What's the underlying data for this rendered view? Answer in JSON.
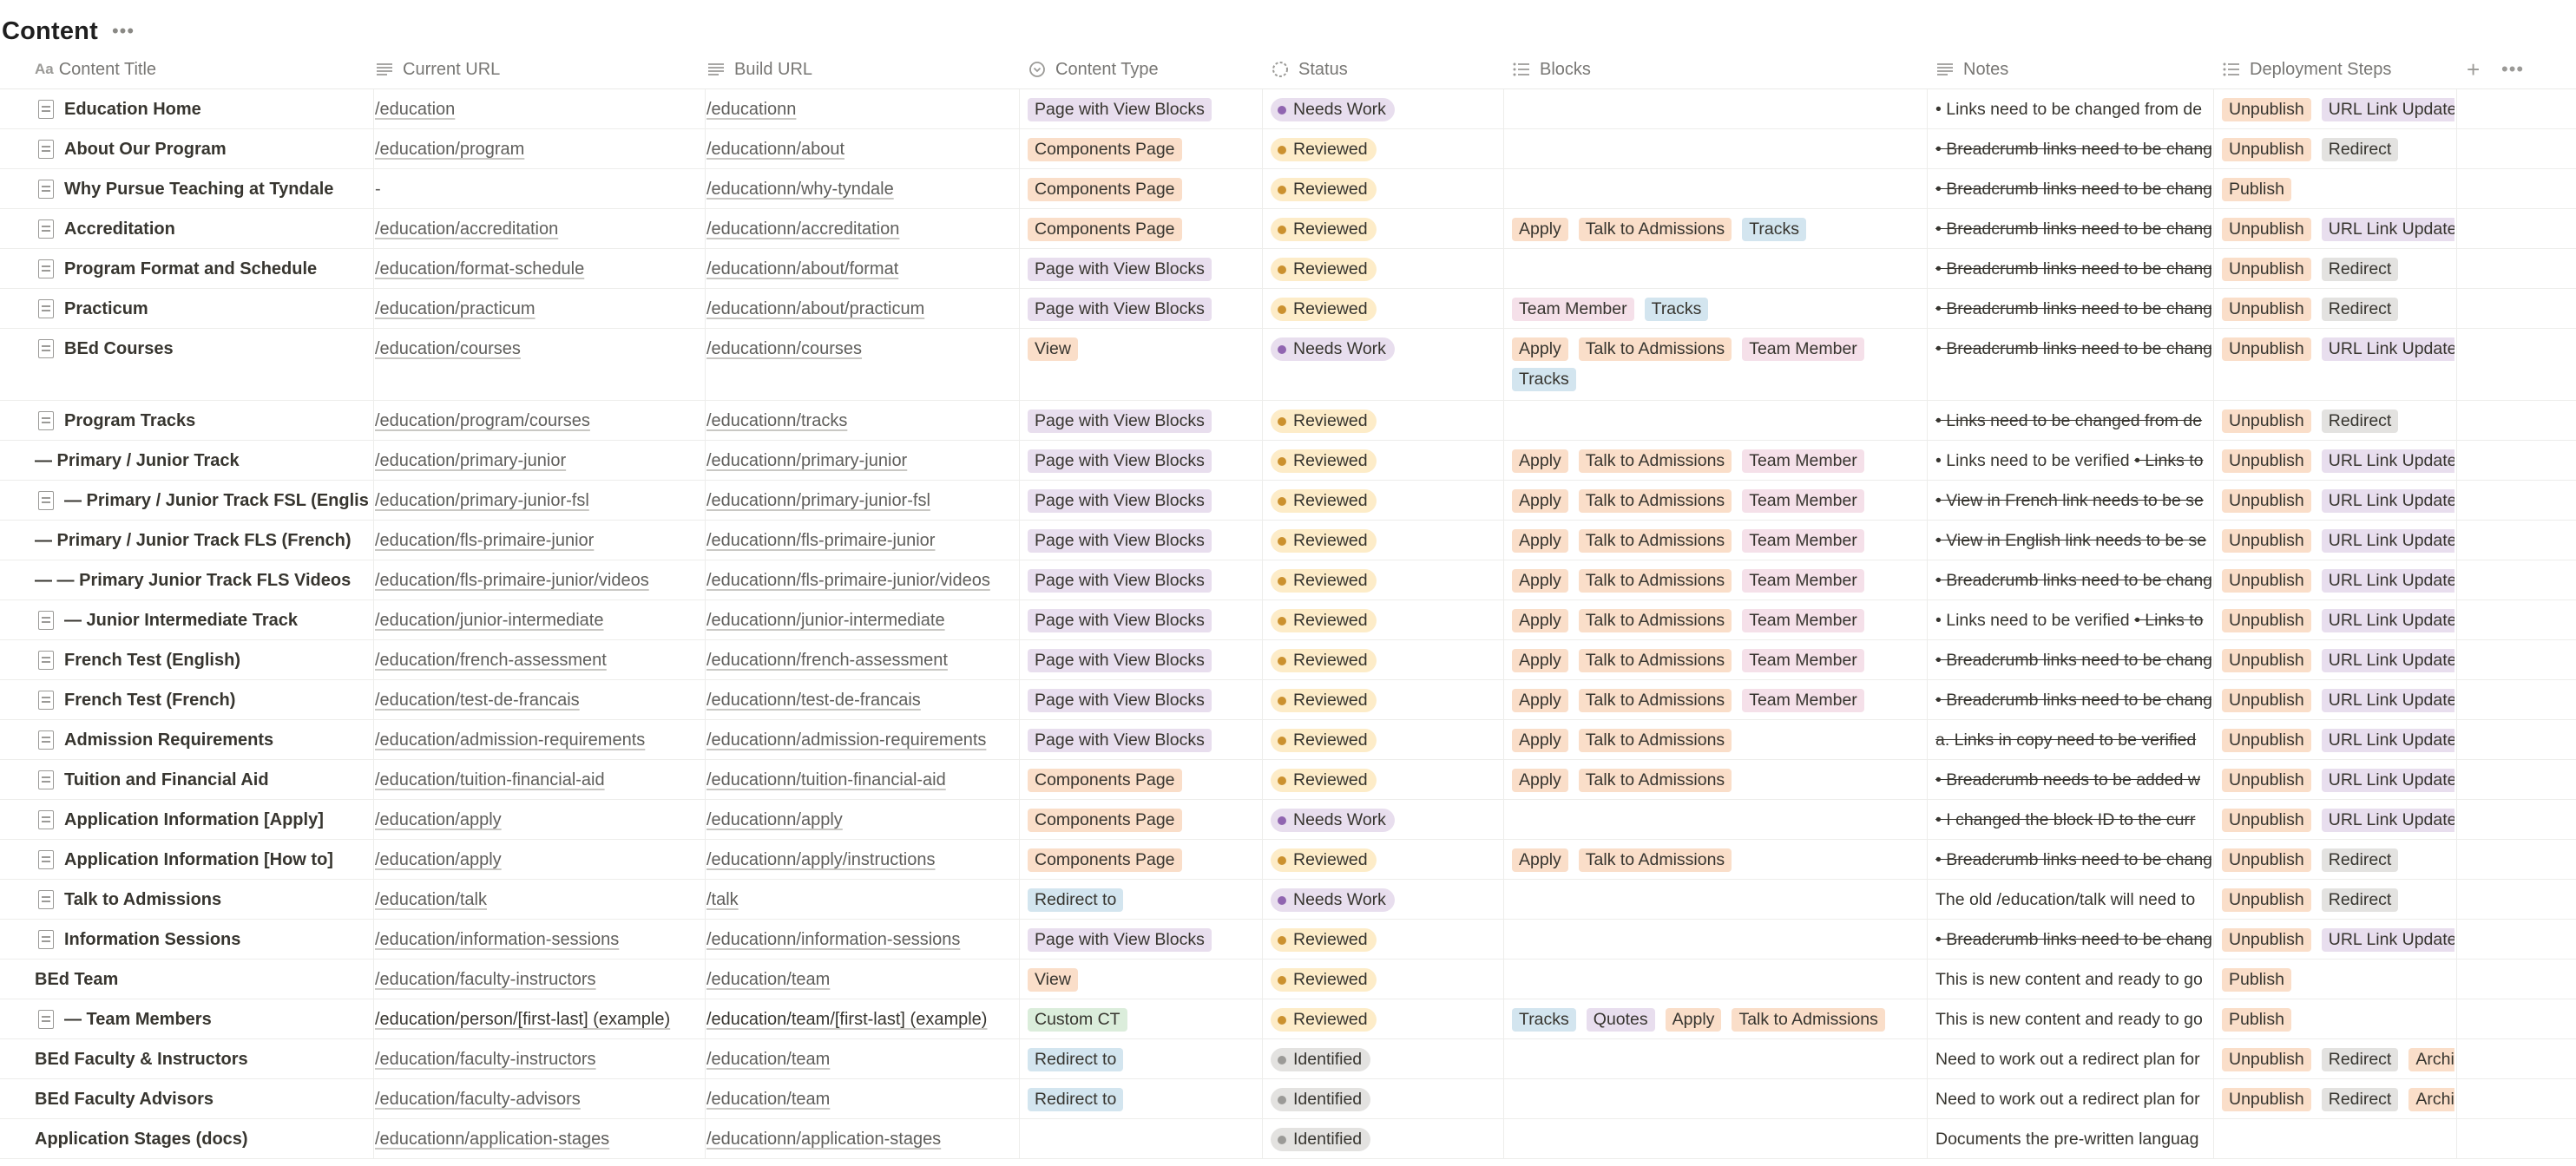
{
  "page": {
    "title": "Content"
  },
  "columns": {
    "content_title": "Content Title",
    "current_url": "Current URL",
    "build_url": "Build URL",
    "content_type": "Content Type",
    "status": "Status",
    "blocks": "Blocks",
    "notes": "Notes",
    "deployment_steps": "Deployment Steps"
  },
  "colors": {
    "Page with View Blocks": "#e8deee",
    "Components Page": "#fadec9",
    "View": "#fadec9",
    "Redirect to": "#d3e5ef",
    "Custom CT": "#dbeddb",
    "Apply": "#fadec9",
    "Talk to Admissions": "#fadec9",
    "Tracks": "#d3e5ef",
    "Team Member": "#f5e0e9",
    "Quotes": "#e8deee",
    "Unpublish": "#fadec9",
    "URL Link Updates": "#e8deee",
    "Redirect": "#e3e2e0",
    "Publish": "#fadec9",
    "Archive": "#fadec9"
  },
  "status_colors": {
    "Needs Work": {
      "bg": "#e8deee",
      "dot": "#9065b0"
    },
    "Reviewed": {
      "bg": "#fdecc8",
      "dot": "#cb912f"
    },
    "Identified": {
      "bg": "#e3e2e0",
      "dot": "#9b9a97"
    }
  },
  "rows": [
    {
      "title": "Education Home",
      "icon": true,
      "current_url": "/education",
      "build_url": "/educationn",
      "type": "Page with View Blocks",
      "status": "Needs Work",
      "blocks": [],
      "note_plain": "• Links need to be changed from de",
      "note_strike": "",
      "deploy": [
        "Unpublish",
        "URL Link Updates"
      ]
    },
    {
      "title": "About Our Program",
      "icon": true,
      "current_url": "/education/program",
      "build_url": "/educationn/about",
      "type": "Components Page",
      "status": "Reviewed",
      "blocks": [],
      "note_plain": "",
      "note_strike": "• Breadcrumb links need to be change",
      "deploy": [
        "Unpublish",
        "Redirect"
      ]
    },
    {
      "title": "Why Pursue Teaching at Tyndale",
      "icon": true,
      "current_url": "-",
      "build_url": "/educationn/why-tyndale",
      "type": "Components Page",
      "status": "Reviewed",
      "blocks": [],
      "note_plain": "",
      "note_strike": "• Breadcrumb links need to be change",
      "deploy": [
        "Publish"
      ]
    },
    {
      "title": "Accreditation",
      "icon": true,
      "current_url": "/education/accreditation",
      "build_url": "/educationn/accreditation",
      "type": "Components Page",
      "status": "Reviewed",
      "blocks": [
        "Apply",
        "Talk to Admissions",
        "Tracks"
      ],
      "note_plain": "",
      "note_strike": "• Breadcrumb links need to be change",
      "deploy": [
        "Unpublish",
        "URL Link Updates"
      ]
    },
    {
      "title": "Program Format and Schedule",
      "icon": true,
      "current_url": "/education/format-schedule",
      "build_url": "/educationn/about/format",
      "type": "Page with View Blocks",
      "status": "Reviewed",
      "blocks": [],
      "note_plain": "",
      "note_strike": "• Breadcrumb links need to be change",
      "deploy": [
        "Unpublish",
        "Redirect"
      ]
    },
    {
      "title": "Practicum",
      "icon": true,
      "current_url": "/education/practicum",
      "build_url": "/educationn/about/practicum",
      "type": "Page with View Blocks",
      "status": "Reviewed",
      "blocks": [
        "Team Member",
        "Tracks"
      ],
      "note_plain": "",
      "note_strike": "• Breadcrumb links need to be change",
      "deploy": [
        "Unpublish",
        "Redirect"
      ]
    },
    {
      "title": "BEd Courses",
      "icon": true,
      "tall": true,
      "current_url": "/education/courses",
      "build_url": "/educationn/courses",
      "type": "View",
      "status": "Needs Work",
      "blocks": [
        "Apply",
        "Talk to Admissions",
        "Team Member",
        "Tracks"
      ],
      "note_plain": "",
      "note_strike": "• Breadcrumb links need to be change",
      "deploy": [
        "Unpublish",
        "URL Link Updates"
      ]
    },
    {
      "title": "Program Tracks",
      "icon": true,
      "current_url": "/education/program/courses",
      "build_url": "/educationn/tracks",
      "type": "Page with View Blocks",
      "status": "Reviewed",
      "blocks": [],
      "note_plain": "",
      "note_strike": "• Links need to be changed from de",
      "deploy": [
        "Unpublish",
        "Redirect"
      ]
    },
    {
      "title": "— Primary / Junior Track",
      "icon": false,
      "current_url": "/education/primary-junior",
      "build_url": "/educationn/primary-junior",
      "type": "Page with View Blocks",
      "status": "Reviewed",
      "blocks": [
        "Apply",
        "Talk to Admissions",
        "Team Member"
      ],
      "note_plain": "• Links need to be verified ",
      "note_strike": "• Links to",
      "deploy": [
        "Unpublish",
        "URL Link Updates"
      ]
    },
    {
      "title": "— Primary / Junior Track FSL (English)",
      "icon": true,
      "current_url": "/education/primary-junior-fsl",
      "build_url": "/educationn/primary-junior-fsl",
      "type": "Page with View Blocks",
      "status": "Reviewed",
      "blocks": [
        "Apply",
        "Talk to Admissions",
        "Team Member"
      ],
      "note_plain": "",
      "note_strike": "• View in French link needs to be se",
      "deploy": [
        "Unpublish",
        "URL Link Updates"
      ]
    },
    {
      "title": "— Primary / Junior Track FLS (French)",
      "icon": false,
      "current_url": "/education/fls-primaire-junior",
      "build_url": "/educationn/fls-primaire-junior",
      "type": "Page with View Blocks",
      "status": "Reviewed",
      "blocks": [
        "Apply",
        "Talk to Admissions",
        "Team Member"
      ],
      "note_plain": "",
      "note_strike": "• View in English link needs to be se",
      "deploy": [
        "Unpublish",
        "URL Link Updates"
      ]
    },
    {
      "title": "— — Primary Junior Track FLS Videos",
      "icon": false,
      "current_url": "/education/fls-primaire-junior/videos",
      "build_url": "/educationn/fls-primaire-junior/videos",
      "type": "Page with View Blocks",
      "status": "Reviewed",
      "blocks": [
        "Apply",
        "Talk to Admissions",
        "Team Member"
      ],
      "note_plain": "",
      "note_strike": "• Breadcrumb links need to be change",
      "deploy": [
        "Unpublish",
        "URL Link Updates"
      ]
    },
    {
      "title": "— Junior Intermediate Track",
      "icon": true,
      "current_url": "/education/junior-intermediate",
      "build_url": "/educationn/junior-intermediate",
      "type": "Page with View Blocks",
      "status": "Reviewed",
      "blocks": [
        "Apply",
        "Talk to Admissions",
        "Team Member"
      ],
      "note_plain": "• Links need to be verified ",
      "note_strike": "• Links to",
      "deploy": [
        "Unpublish",
        "URL Link Updates"
      ]
    },
    {
      "title": "French Test (English)",
      "icon": true,
      "current_url": "/education/french-assessment",
      "build_url": "/educationn/french-assessment",
      "type": "Page with View Blocks",
      "status": "Reviewed",
      "blocks": [
        "Apply",
        "Talk to Admissions",
        "Team Member"
      ],
      "note_plain": "",
      "note_strike": "• Breadcrumb links need to be change",
      "deploy": [
        "Unpublish",
        "URL Link Updates"
      ]
    },
    {
      "title": "French Test (French)",
      "icon": true,
      "current_url": "/education/test-de-francais",
      "build_url": "/educationn/test-de-francais",
      "type": "Page with View Blocks",
      "status": "Reviewed",
      "blocks": [
        "Apply",
        "Talk to Admissions",
        "Team Member"
      ],
      "note_plain": "",
      "note_strike": "• Breadcrumb links need to be change",
      "deploy": [
        "Unpublish",
        "URL Link Updates"
      ]
    },
    {
      "title": "Admission Requirements",
      "icon": true,
      "current_url": "/education/admission-requirements",
      "build_url": "/educationn/admission-requirements",
      "type": "Page with View Blocks",
      "status": "Reviewed",
      "blocks": [
        "Apply",
        "Talk to Admissions"
      ],
      "note_plain": "",
      "note_strike": "a. Links in copy need to be verified",
      "deploy": [
        "Unpublish",
        "URL Link Updates"
      ]
    },
    {
      "title": "Tuition and Financial Aid",
      "icon": true,
      "current_url": "/education/tuition-financial-aid",
      "build_url": "/educationn/tuition-financial-aid",
      "type": "Components Page",
      "status": "Reviewed",
      "blocks": [
        "Apply",
        "Talk to Admissions"
      ],
      "note_plain": "",
      "note_strike": "• Breadcrumb needs to be added w",
      "deploy": [
        "Unpublish",
        "URL Link Updates"
      ]
    },
    {
      "title": "Application Information [Apply]",
      "icon": true,
      "current_url": "/education/apply",
      "build_url": "/educationn/apply",
      "type": "Components Page",
      "status": "Needs Work",
      "blocks": [],
      "note_plain": "",
      "note_strike": "• I changed the block ID to the curr",
      "deploy": [
        "Unpublish",
        "URL Link Updates"
      ]
    },
    {
      "title": "Application Information [How to]",
      "icon": true,
      "current_url": "/education/apply",
      "build_url": "/educationn/apply/instructions",
      "type": "Components Page",
      "status": "Reviewed",
      "blocks": [
        "Apply",
        "Talk to Admissions"
      ],
      "note_plain": "",
      "note_strike": "• Breadcrumb links need to be change",
      "deploy": [
        "Unpublish",
        "Redirect"
      ]
    },
    {
      "title": "Talk to Admissions",
      "icon": true,
      "current_url": "/education/talk",
      "build_url": "/talk",
      "type": "Redirect to",
      "status": "Needs Work",
      "blocks": [],
      "note_plain": "The old /education/talk will need to",
      "note_strike": "",
      "deploy": [
        "Unpublish",
        "Redirect"
      ]
    },
    {
      "title": "Information Sessions",
      "icon": true,
      "current_url": "/education/information-sessions",
      "build_url": "/educationn/information-sessions",
      "type": "Page with View Blocks",
      "status": "Reviewed",
      "blocks": [],
      "note_plain": "",
      "note_strike": "• Breadcrumb links need to be change",
      "deploy": [
        "Unpublish",
        "URL Link Updates"
      ]
    },
    {
      "title": "BEd Team",
      "icon": false,
      "current_url": "/education/faculty-instructors",
      "build_url": "/education/team",
      "type": "View",
      "status": "Reviewed",
      "blocks": [],
      "note_plain": "This is new content and ready to go",
      "note_strike": "",
      "deploy": [
        "Publish"
      ]
    },
    {
      "title": "— Team Members",
      "icon": true,
      "current_url": "/education/person/[first-last] (example)",
      "build_url": "/education/team/[first-last] (example)",
      "type": "Custom CT",
      "status": "Reviewed",
      "blocks": [
        "Tracks",
        "Quotes",
        "Apply",
        "Talk to Admissions"
      ],
      "note_plain": "This is new content and ready to go",
      "note_strike": "",
      "deploy": [
        "Publish"
      ]
    },
    {
      "title": "BEd Faculty & Instructors",
      "icon": false,
      "current_url": "/education/faculty-instructors",
      "build_url": "/education/team",
      "type": "Redirect to",
      "status": "Identified",
      "blocks": [],
      "note_plain": "Need to work out a redirect plan for",
      "note_strike": "",
      "deploy": [
        "Unpublish",
        "Redirect",
        "Archive"
      ]
    },
    {
      "title": "BEd Faculty Advisors",
      "icon": false,
      "current_url": "/education/faculty-advisors",
      "build_url": "/education/team",
      "type": "Redirect to",
      "status": "Identified",
      "blocks": [],
      "note_plain": "Need to work out a redirect plan for",
      "note_strike": "",
      "deploy": [
        "Unpublish",
        "Redirect",
        "Archive"
      ]
    },
    {
      "title": "Application Stages (docs)",
      "icon": false,
      "current_url": "/educationn/application-stages",
      "build_url": "/educationn/application-stages",
      "type": "",
      "status": "Identified",
      "blocks": [],
      "note_plain": "Documents the pre-written languag",
      "note_strike": "",
      "deploy": []
    }
  ]
}
